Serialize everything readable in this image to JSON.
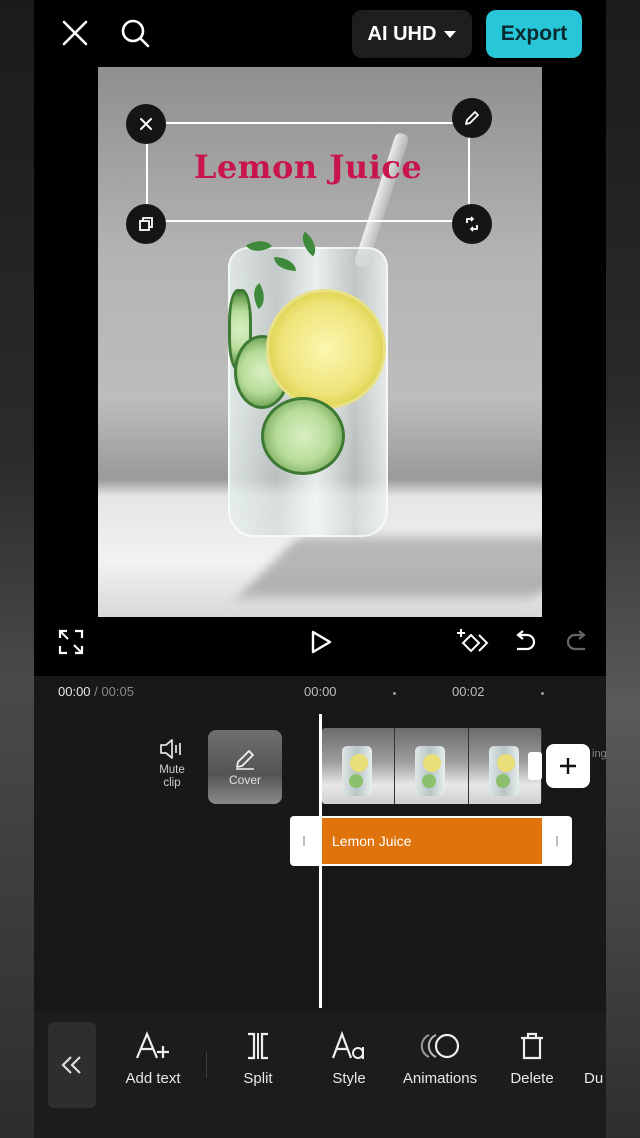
{
  "topbar": {
    "quality_label": "AI UHD",
    "export_label": "Export"
  },
  "preview": {
    "overlay_text": "Lemon Juice",
    "overlay_color": "#c8164d"
  },
  "timeline": {
    "current_time": "00:00",
    "total_time": "/ 00:05",
    "ruler": [
      "00:00",
      "00:02"
    ],
    "mute_label": "Mute\nclip",
    "cover_label": "Cover",
    "text_clip_label": "Lemon Juice",
    "text_clip_color": "#e0740c",
    "clip_tail": "ing"
  },
  "toolbar": {
    "items": [
      {
        "label": "Add text",
        "icon": "add-text-icon"
      },
      {
        "label": "Split",
        "icon": "split-icon"
      },
      {
        "label": "Style",
        "icon": "style-icon"
      },
      {
        "label": "Animations",
        "icon": "animations-icon"
      },
      {
        "label": "Delete",
        "icon": "delete-icon"
      },
      {
        "label": "Du",
        "icon": "duplicate-icon"
      }
    ]
  },
  "colors": {
    "accent": "#27c6d8",
    "text_clip": "#e0740c"
  }
}
